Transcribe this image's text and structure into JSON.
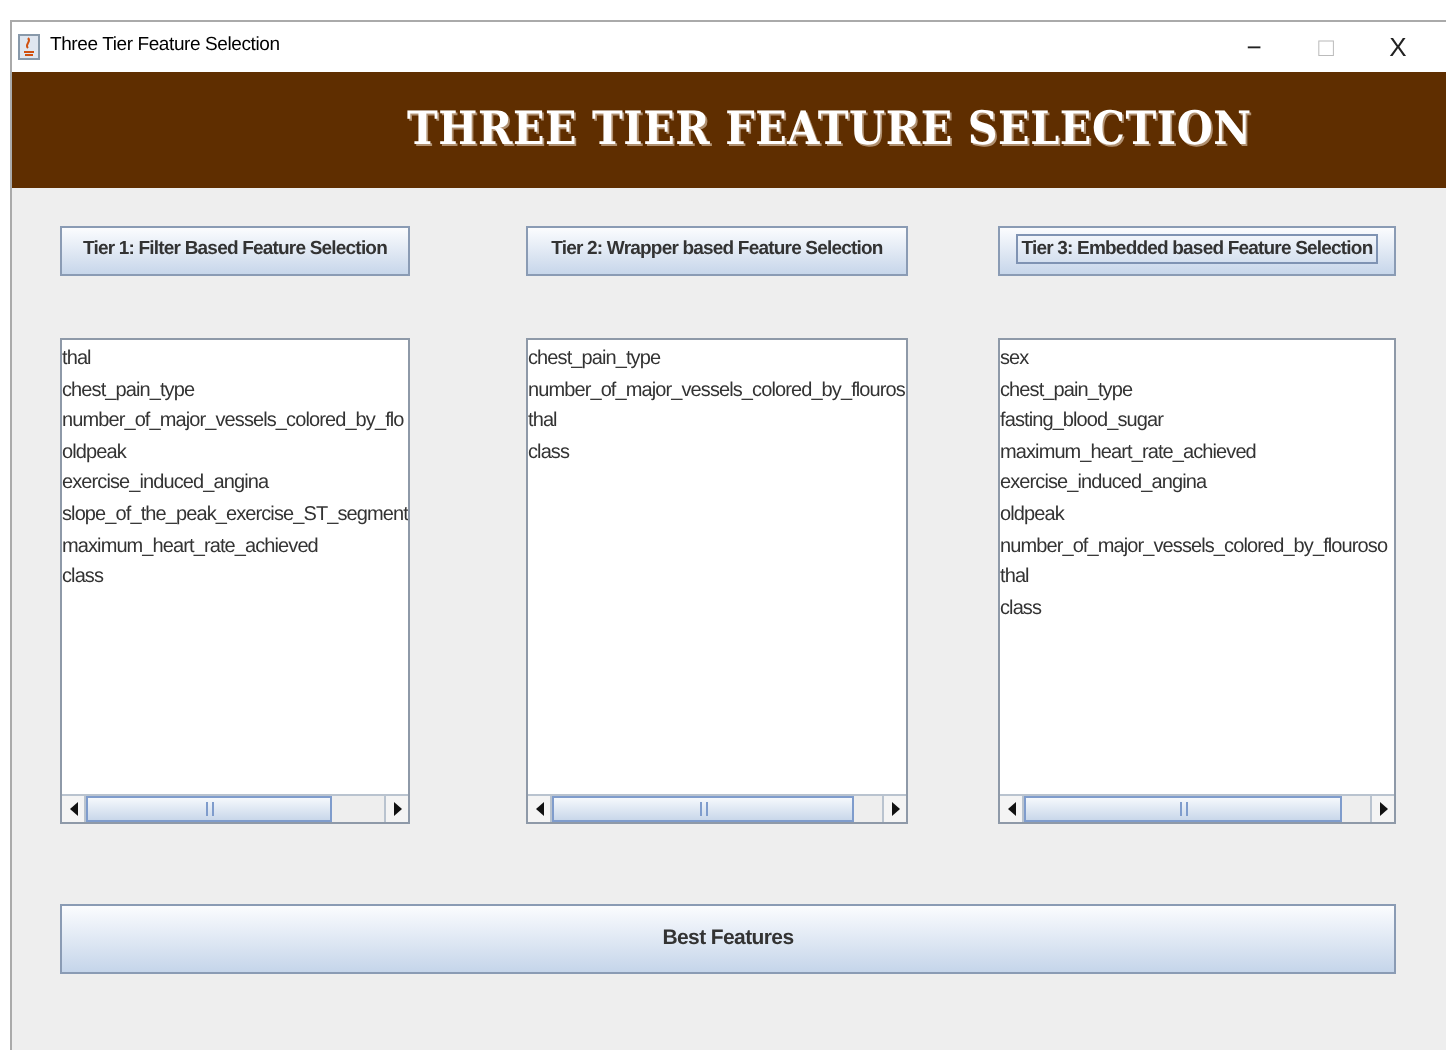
{
  "window": {
    "title": "Three Tier Feature Selection",
    "controls": [
      "−",
      "□",
      "X"
    ]
  },
  "header": {
    "title": "THREE TIER FEATURE SELECTION"
  },
  "tiers": [
    {
      "button": "Tier 1: Filter Based Feature Selection",
      "focused": false,
      "features": [
        "thal",
        "chest_pain_type",
        "number_of_major_vessels_colored_by_flo",
        "oldpeak",
        "exercise_induced_angina",
        "slope_of_the_peak_exercise_ST_segment",
        "maximum_heart_rate_achieved",
        "class"
      ]
    },
    {
      "button": "Tier 2: Wrapper based Feature Selection",
      "focused": false,
      "features": [
        "chest_pain_type",
        "number_of_major_vessels_colored_by_flouros",
        "thal",
        "class"
      ]
    },
    {
      "button": "Tier 3: Embedded based Feature Selection",
      "focused": true,
      "features": [
        "sex",
        "chest_pain_type",
        "fasting_blood_sugar",
        "maximum_heart_rate_achieved",
        "exercise_induced_angina",
        "oldpeak",
        "number_of_major_vessels_colored_by_flouroso",
        "thal",
        "class"
      ]
    }
  ],
  "best_button": "Best Features"
}
